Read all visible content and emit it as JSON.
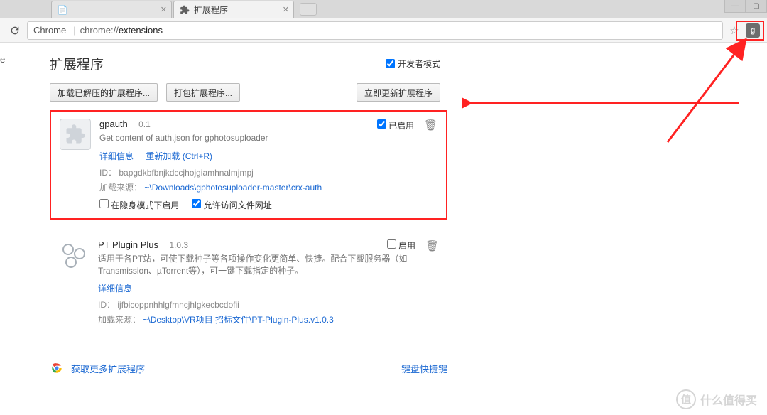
{
  "window": {
    "tab1_title": "",
    "tab2_title": "扩展程序"
  },
  "addr": {
    "scheme": "Chrome",
    "host": "chrome://",
    "path": "extensions"
  },
  "sidebar": {
    "label": "e"
  },
  "header": {
    "title": "扩展程序",
    "dev_mode": "开发者模式"
  },
  "buttons": {
    "load_unpacked": "加载已解压的扩展程序...",
    "pack": "打包扩展程序...",
    "update_now": "立即更新扩展程序"
  },
  "ext1": {
    "name": "gpauth",
    "version": "0.1",
    "desc": "Get content of auth.json for gphotosuploader",
    "details": "详细信息",
    "reload": "重新加载 (Ctrl+R)",
    "id_label": "ID：",
    "id": "bapgdkbfbnjkdccjhojgiamhnalmjmpj",
    "src_label": "加载来源：",
    "src": "~\\Downloads\\gphotosuploader-master\\crx-auth",
    "incognito": "在隐身模式下启用",
    "allow_file": "允许访问文件网址",
    "enabled": "已启用"
  },
  "ext2": {
    "name": "PT Plugin Plus",
    "version": "1.0.3",
    "desc": "适用于各PT站，可使下载种子等各项操作变化更简单、快捷。配合下载服务器（如Transmission、µTorrent等），可一键下载指定的种子。",
    "details": "详细信息",
    "id_label": "ID：",
    "id": "ijfbicoppnhhlgfmncjhlgkecbcdofii",
    "src_label": "加载来源：",
    "src": "~\\Desktop\\VR项目 招标文件\\PT-Plugin-Plus.v1.0.3",
    "enable": "启用"
  },
  "footer": {
    "more": "获取更多扩展程序",
    "shortcuts": "键盘快捷键"
  },
  "watermark": {
    "text": "什么值得买",
    "badge": "值"
  },
  "ext_button": "g"
}
